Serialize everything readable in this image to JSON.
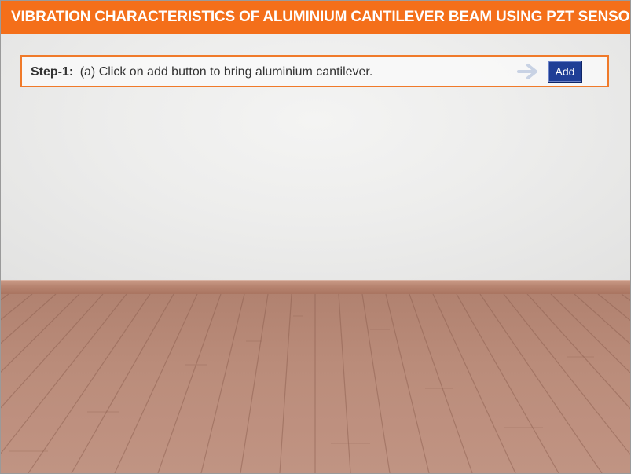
{
  "header": {
    "title": "VIBRATION CHARACTERISTICS OF ALUMINIUM CANTILEVER BEAM USING PZT SENSOR"
  },
  "step": {
    "label": "Step-1:",
    "instruction": "(a) Click on add button to bring aluminium cantilever.",
    "arrow_icon": "arrow-right-icon",
    "add_label": "Add"
  },
  "colors": {
    "header_bg": "#f46f1a",
    "step_border": "#f07a2a",
    "button_bg": "#1f3e96",
    "arrow": "#c8d2e4"
  }
}
